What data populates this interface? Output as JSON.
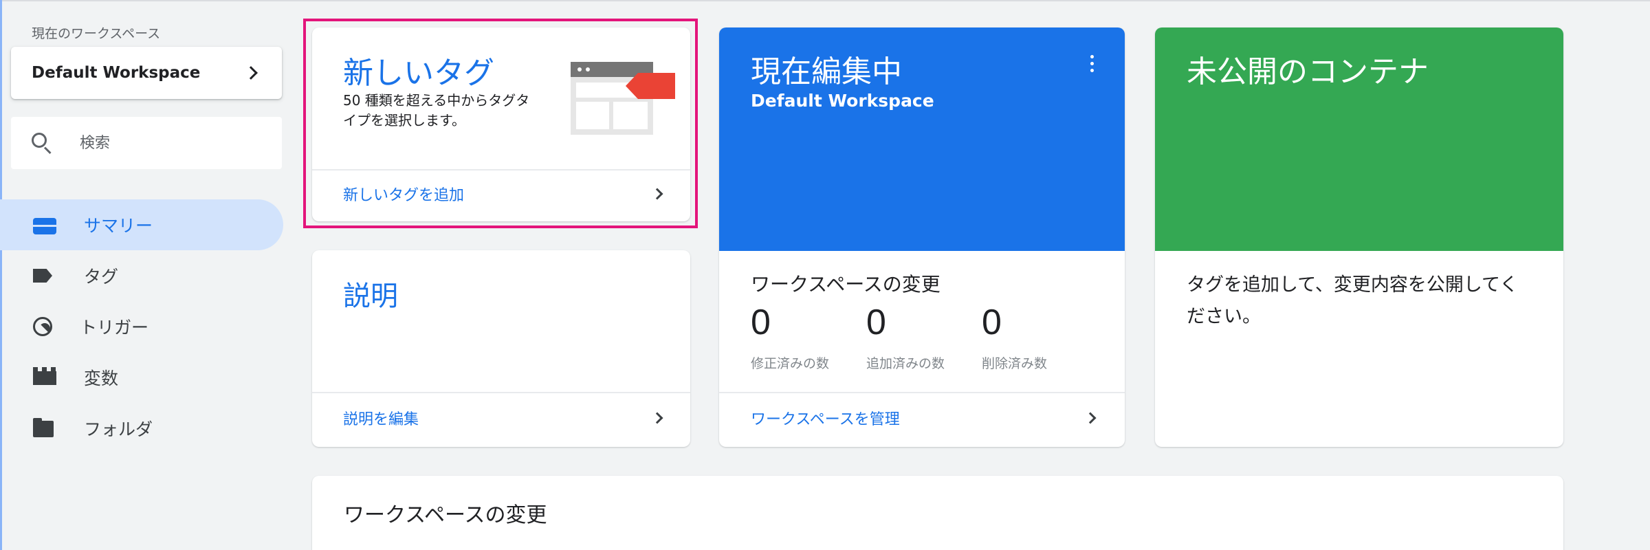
{
  "sidebar": {
    "workspace_caption": "現在のワークスペース",
    "workspace_name": "Default Workspace",
    "search_placeholder": "検索",
    "items": [
      {
        "label": "サマリー",
        "icon": "summary-icon",
        "active": true
      },
      {
        "label": "タグ",
        "icon": "tag-icon",
        "active": false
      },
      {
        "label": "トリガー",
        "icon": "trigger-icon",
        "active": false
      },
      {
        "label": "変数",
        "icon": "variable-icon",
        "active": false
      },
      {
        "label": "フォルダ",
        "icon": "folder-icon",
        "active": false
      }
    ]
  },
  "new_tag_card": {
    "title": "新しいタグ",
    "description": "50 種類を超える中からタグタイプを選択します。",
    "action": "新しいタグを追加"
  },
  "description_card": {
    "title": "説明",
    "action": "説明を編集"
  },
  "editing_card": {
    "title": "現在編集中",
    "workspace": "Default Workspace",
    "changes_label": "ワークスペースの変更",
    "counts": [
      {
        "value": "0",
        "label": "修正済みの数"
      },
      {
        "value": "0",
        "label": "追加済みの数"
      },
      {
        "value": "0",
        "label": "削除済み数"
      }
    ],
    "action": "ワークスペースを管理"
  },
  "unpublished_card": {
    "title": "未公開のコンテナ",
    "body": "タグを追加して、変更内容を公開してください。"
  },
  "changes_card": {
    "title": "ワークスペースの変更"
  },
  "colors": {
    "accent": "#1a73e8",
    "editing_header": "#1a73e8",
    "unpublished_header": "#34a853",
    "highlight_border": "#e3157b",
    "active_nav_bg": "#d2e3fc"
  }
}
